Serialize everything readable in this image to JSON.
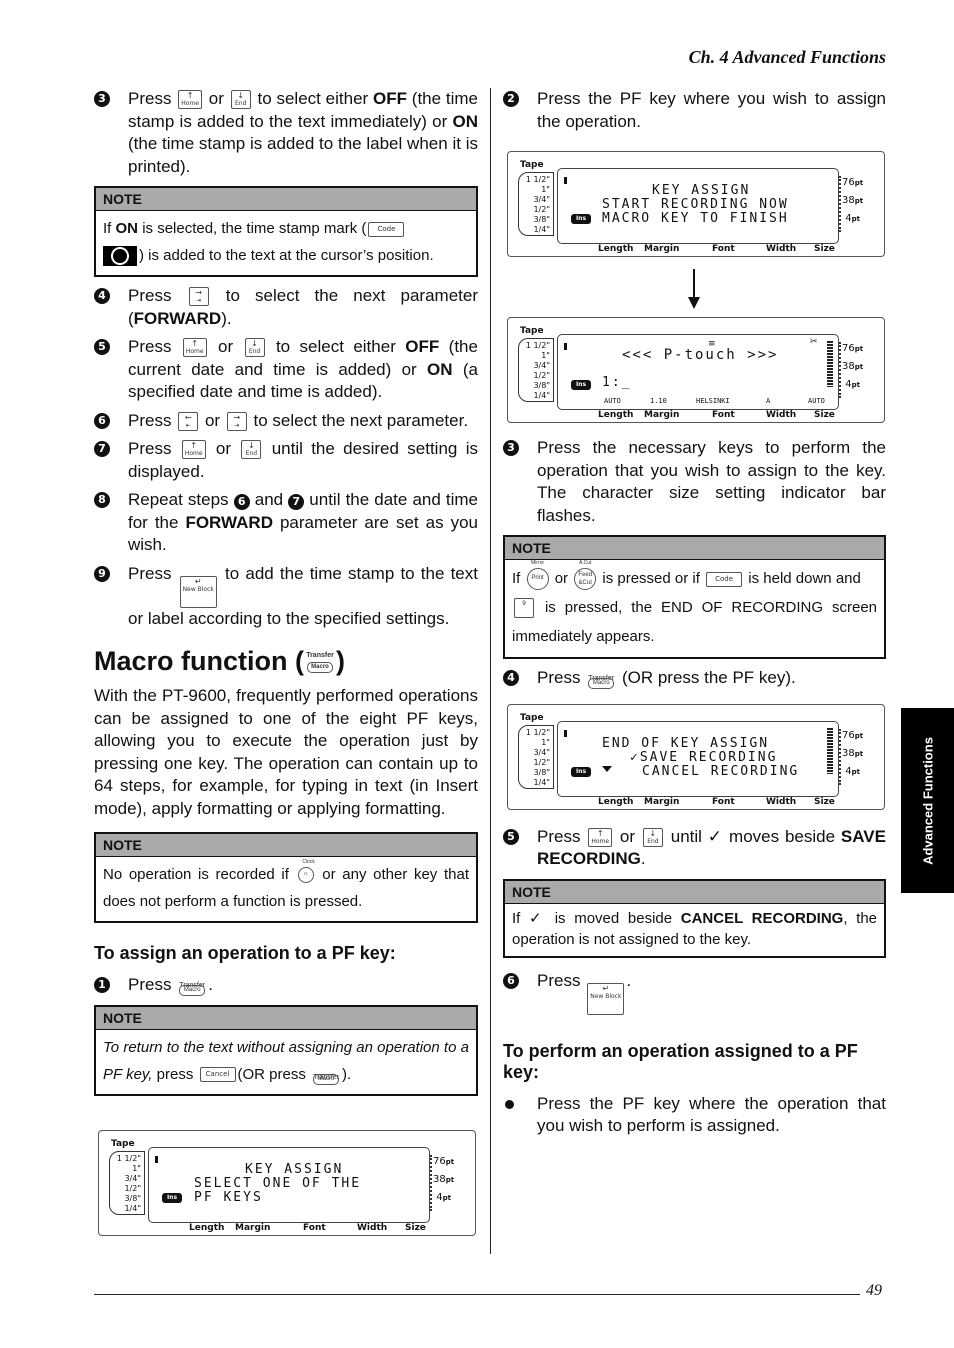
{
  "header": {
    "running_head": "Ch. 4 Advanced Functions"
  },
  "side_tab": {
    "label": "Advanced Functions"
  },
  "footer": {
    "page_number": "49"
  },
  "keys": {
    "home": {
      "arrow": "↑",
      "label": "Home"
    },
    "end": {
      "arrow": "↓",
      "label": "End"
    },
    "tab_right": {
      "arrow": "→",
      "label": "⇥"
    },
    "tab_left": {
      "arrow": "←",
      "label": "⇤"
    },
    "new_block": {
      "arrow": "↵",
      "label": "New Block"
    },
    "code": "Code",
    "cancel": "Cancel",
    "macro": {
      "top": "Transfer",
      "label": "Macro"
    },
    "clock": {
      "top": "Clock",
      "label": "☼"
    },
    "print": {
      "top": "Mirror",
      "label": "Print"
    },
    "feed": {
      "top": "A.Cut",
      "label": "Feed &Cut"
    },
    "nine": {
      "top": "Layout Preview",
      "label": "9"
    }
  },
  "left": {
    "step3": {
      "num": "3",
      "press": "Press",
      "or": "or",
      "t1": "to select either",
      "off": "OFF",
      "t2": "(the time stamp is added to the text immediately) or",
      "on": "ON",
      "t3": "(the time stamp is added to the label when it is printed)."
    },
    "note1": {
      "title": "NOTE",
      "t1": "If",
      "on": "ON",
      "t2": "is selected, the time stamp mark (",
      "t3": ") is added to the text at the cursor’s position."
    },
    "step4": {
      "num": "4",
      "press": "Press",
      "t1": "to select the next parameter (",
      "fw": "FORWARD",
      "t2": ")."
    },
    "step5": {
      "num": "5",
      "press": "Press",
      "or": "or",
      "t1": "to select either",
      "off": "OFF",
      "t2": "(the current date and time is added) or",
      "on": "ON",
      "t3": "(a specified date and time is added)."
    },
    "step6": {
      "num": "6",
      "press": "Press",
      "or": "or",
      "t1": "to select the next parameter."
    },
    "step7": {
      "num": "7",
      "press": "Press",
      "or": "or",
      "t1": "until the desired setting is displayed."
    },
    "step8": {
      "num": "8",
      "t1": "Repeat steps",
      "n6": "6",
      "and": "and",
      "n7": "7",
      "t2": "until the date and time for the",
      "fw": "FORWARD",
      "t3": "parameter are set as you wish."
    },
    "step9": {
      "num": "9",
      "press": "Press",
      "t1": "to add the time stamp to the text or label according to the specified settings."
    },
    "macro_heading": "Macro function (",
    "macro_heading_close": ")",
    "intro": "With the PT-9600, frequently performed operations can be assigned to one of the eight PF keys, allowing you to execute the operation just by pressing one key. The operation can contain up to 64 steps, for example, for typing in text (in Insert mode), apply formatting or applying formatting.",
    "note2": {
      "title": "NOTE",
      "t1": "No operation is recorded if",
      "t2": "or any other key that does not perform a function is pressed."
    },
    "assign_heading": "To assign an operation to a PF key:",
    "astep1": {
      "num": "1",
      "press": "Press",
      "t1": "."
    },
    "note3": {
      "title": "NOTE",
      "t1": "To return to the text without assigning an operation to a PF key,",
      "press": "press",
      "t2": "(OR press",
      "t3": ")."
    },
    "lcd1": {
      "lines": [
        "KEY ASSIGN",
        "SELECT ONE OF THE",
        "PF KEYS"
      ]
    }
  },
  "right": {
    "astep2": {
      "num": "2",
      "t1": "Press the PF key where you wish to assign the operation."
    },
    "lcd2": {
      "lines": [
        "KEY ASSIGN",
        "START RECORDING NOW",
        "MACRO KEY TO FINISH"
      ]
    },
    "lcd3": {
      "lines": [
        "<<< P-touch >>>",
        "1:_"
      ],
      "status": [
        "AUTO",
        "1.10",
        "HELSINKI",
        "A",
        "AUTO"
      ]
    },
    "astep3": {
      "num": "3",
      "t1": "Press the necessary keys to perform the operation that you wish to assign to the key. The character size setting indicator bar flashes."
    },
    "note4": {
      "title": "NOTE",
      "t1": "If",
      "or": "or",
      "t2": "is pressed or if",
      "t3": "is held down and",
      "t4": "is pressed, the END OF RECORDING screen immediately appears."
    },
    "astep4": {
      "num": "4",
      "press": "Press",
      "t1": "(OR press the PF key)."
    },
    "lcd4": {
      "lines": [
        "END OF KEY ASSIGN",
        "✓SAVE RECORDING",
        "CANCEL RECORDING"
      ]
    },
    "astep5": {
      "num": "5",
      "press": "Press",
      "or": "or",
      "t1": "until ✓ moves beside",
      "save": "SAVE RECORDING",
      "t2": "."
    },
    "note5": {
      "title": "NOTE",
      "t1": "If ✓ is moved beside",
      "cancel": "CANCEL RECORDING",
      "t2": ", the operation is not assigned to the key."
    },
    "astep6": {
      "num": "6",
      "press": "Press",
      "t1": "."
    },
    "perform_heading": "To perform an operation assigned to a PF key:",
    "bullet1": "Press the PF key where the operation that you wish to perform is assigned."
  },
  "lcd_common": {
    "tape_label": "Tape",
    "tape_sizes": [
      "1 1/2\"",
      "1\"",
      "3/4\"",
      "1/2\"",
      "3/8\"",
      "1/4\""
    ],
    "ins": "Ins",
    "pt_sizes": [
      "76",
      "38",
      "4"
    ],
    "pt_unit": "pt",
    "bottom_labels": [
      "Length",
      "Margin",
      "Font",
      "Width",
      "Size"
    ]
  }
}
